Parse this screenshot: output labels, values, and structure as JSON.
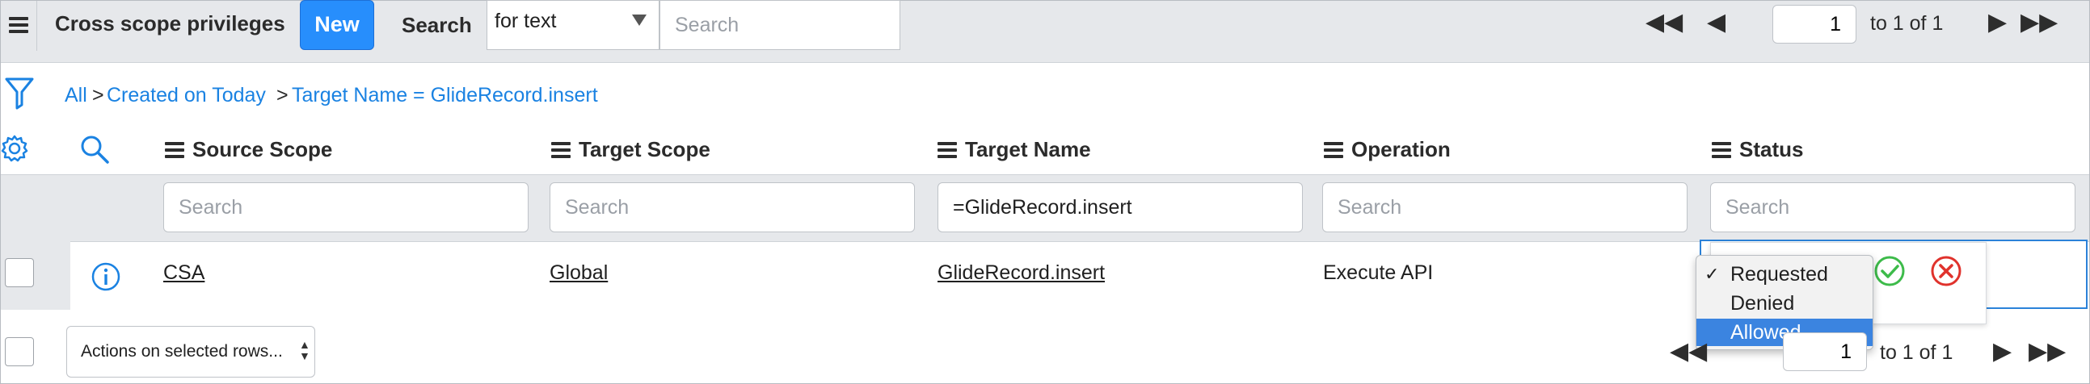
{
  "header": {
    "title": "Cross scope privileges",
    "new_label": "New",
    "search_label": "Search",
    "search_field_value": "for text",
    "search_placeholder": "Search",
    "page_value": "1",
    "page_of": "to 1 of 1"
  },
  "breadcrumb": {
    "items": [
      "All",
      "Created on Today",
      "Target Name = GlideRecord.insert"
    ],
    "separator": ">"
  },
  "columns": [
    "Source Scope",
    "Target Scope",
    "Target Name",
    "Operation",
    "Status"
  ],
  "filters": {
    "placeholder": "Search",
    "target_name_value": "=GlideRecord.insert"
  },
  "row": {
    "source_scope": "CSA",
    "target_scope": "Global",
    "target_name": "GlideRecord.insert",
    "operation": "Execute API"
  },
  "status_dropdown": {
    "options": [
      "Requested",
      "Denied",
      "Allowed"
    ],
    "checked": "Requested",
    "highlighted": "Allowed"
  },
  "footer": {
    "actions_label": "Actions on selected rows...",
    "page_value": "1",
    "page_of": "to 1 of 1"
  },
  "colors": {
    "accent": "#278efc",
    "link": "#1a82e2",
    "header_bg": "#e6e8eb",
    "highlight": "#3b84e0",
    "ok": "#3dbb4a",
    "cancel": "#e0322c"
  }
}
